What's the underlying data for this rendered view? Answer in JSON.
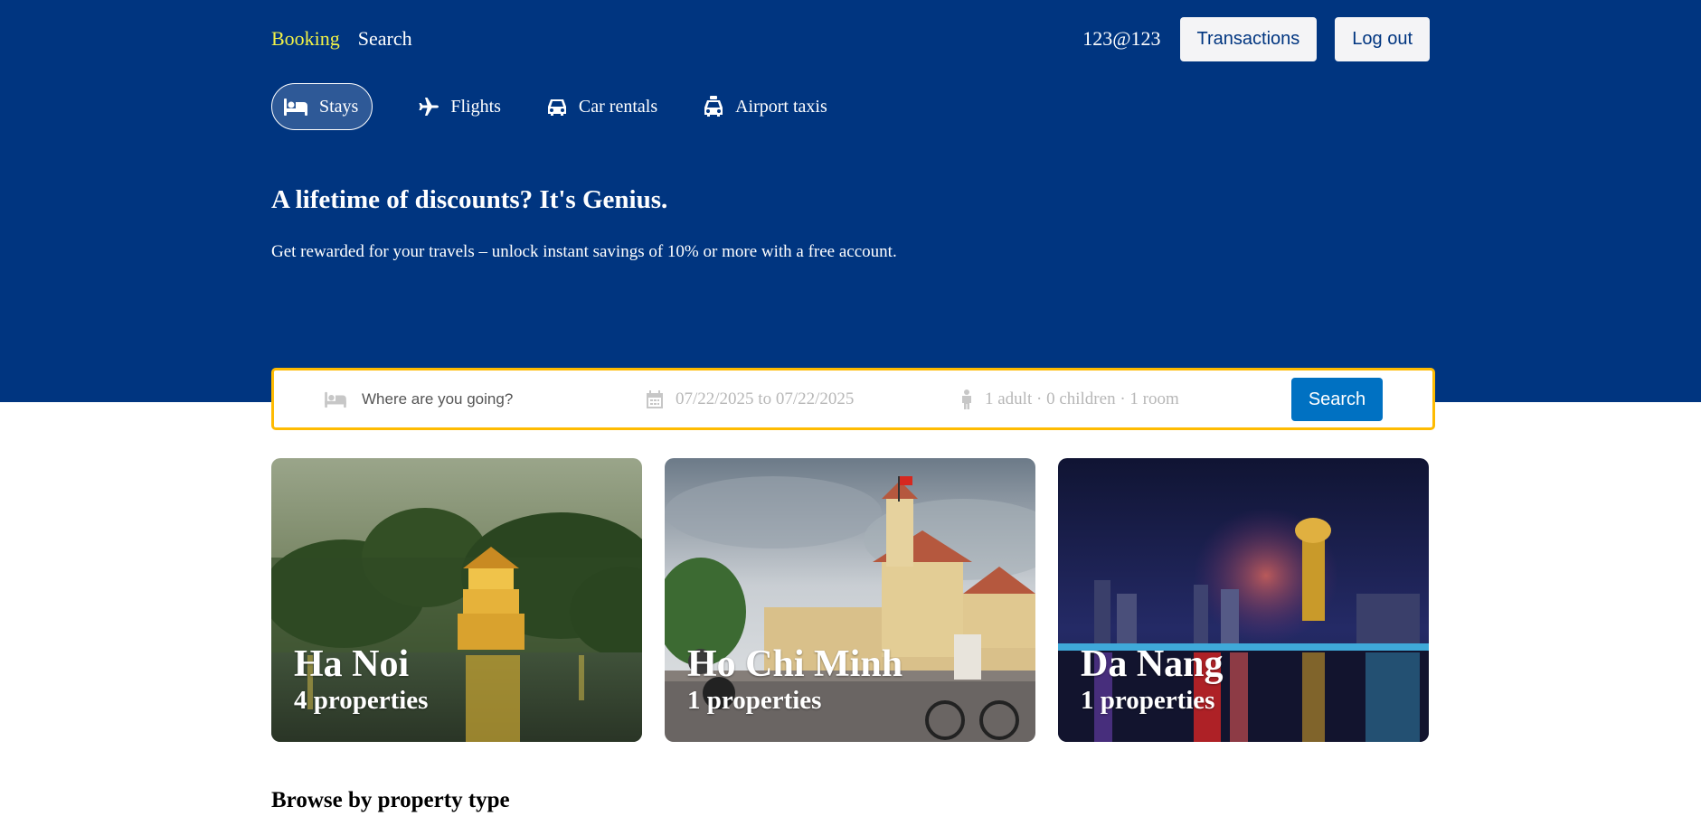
{
  "navbar": {
    "brand": "Booking",
    "search_link": "Search",
    "user": "123@123",
    "transactions_label": "Transactions",
    "logout_label": "Log out"
  },
  "header_list": [
    {
      "label": "Stays",
      "icon": "bed-icon",
      "active": true
    },
    {
      "label": "Flights",
      "icon": "plane-icon",
      "active": false
    },
    {
      "label": "Car rentals",
      "icon": "car-icon",
      "active": false
    },
    {
      "label": "Airport taxis",
      "icon": "taxi-icon",
      "active": false
    }
  ],
  "hero": {
    "title": "A lifetime of discounts? It's Genius.",
    "description": "Get rewarded for your travels – unlock instant savings of 10% or more with a free account."
  },
  "search": {
    "destination_placeholder": "Where are you going?",
    "dates": "07/22/2025 to 07/22/2025",
    "options": "1 adult · 0 children · 1 room",
    "button_label": "Search"
  },
  "featured": [
    {
      "city": "Ha Noi",
      "count": "4 properties"
    },
    {
      "city": "Ho Chi Minh",
      "count": "1 properties"
    },
    {
      "city": "Da Nang",
      "count": "1 properties"
    }
  ],
  "section": {
    "browse_title": "Browse by property type"
  },
  "colors": {
    "hero_bg": "#003580",
    "brand": "#f1f247",
    "accent": "#0071c2",
    "search_border": "#febb02"
  }
}
